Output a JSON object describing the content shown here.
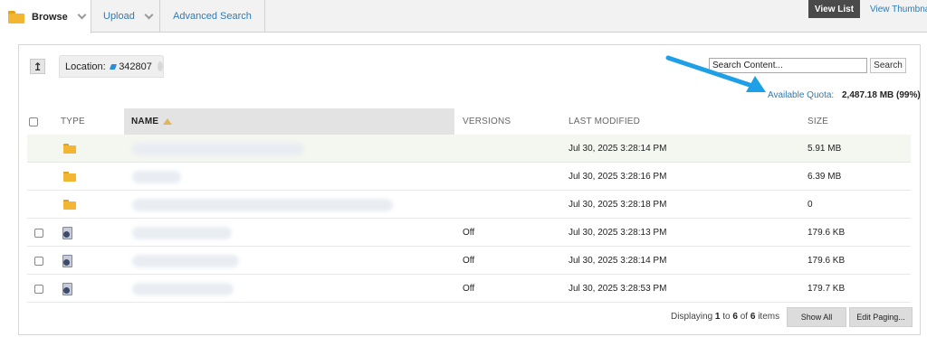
{
  "tabs": {
    "browse_label": "Browse",
    "upload_label": "Upload",
    "advanced_search_label": "Advanced Search"
  },
  "view": {
    "view_list_label": "View List",
    "view_thumbnails_label": "View Thumbnails"
  },
  "location": {
    "label": "Location:",
    "value": "342807"
  },
  "search": {
    "value": "Search Content...",
    "button_label": "Search"
  },
  "quota": {
    "label": "Available Quota:",
    "value": "2,487.18 MB (99%)"
  },
  "columns": {
    "type": "TYPE",
    "name": "NAME",
    "versions": "VERSIONS",
    "last_modified": "LAST MODIFIED",
    "size": "SIZE"
  },
  "rows": [
    {
      "kind": "folder",
      "versions": "",
      "modified": "Jul 30, 2025 3:28:14 PM",
      "size": "5.91 MB"
    },
    {
      "kind": "folder",
      "versions": "",
      "modified": "Jul 30, 2025 3:28:16 PM",
      "size": "6.39 MB"
    },
    {
      "kind": "folder",
      "versions": "",
      "modified": "Jul 30, 2025 3:28:18 PM",
      "size": "0"
    },
    {
      "kind": "file",
      "versions": "Off",
      "modified": "Jul 30, 2025 3:28:13 PM",
      "size": "179.6 KB"
    },
    {
      "kind": "file",
      "versions": "Off",
      "modified": "Jul 30, 2025 3:28:14 PM",
      "size": "179.6 KB"
    },
    {
      "kind": "file",
      "versions": "Off",
      "modified": "Jul 30, 2025 3:28:53 PM",
      "size": "179.7 KB"
    }
  ],
  "footer": {
    "displaying_prefix": "Displaying",
    "from": "1",
    "to_word": "to",
    "to": "6",
    "of_word": "of",
    "total": "6",
    "items_word": "items",
    "show_all_label": "Show All",
    "edit_paging_label": "Edit Paging..."
  },
  "colors": {
    "link": "#2b7bb9",
    "folder": "#f2b632",
    "annotation_arrow": "#1ea0e8"
  }
}
